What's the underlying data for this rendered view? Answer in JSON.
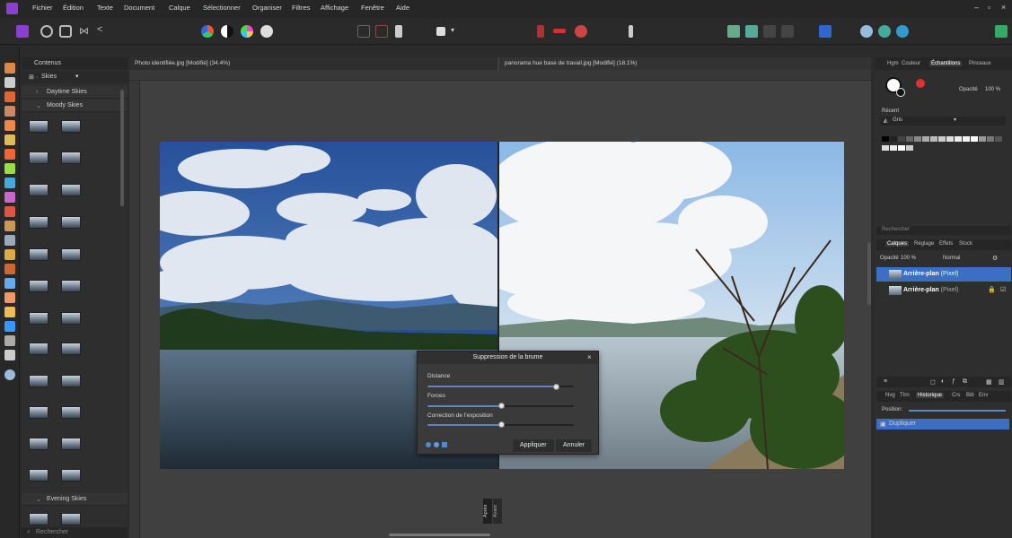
{
  "menu": [
    "Fichier",
    "Édition",
    "Texte",
    "Document",
    "Calque",
    "Sélectionner",
    "Organiser",
    "Filtres",
    "Affichage",
    "Fenêtre",
    "Aide"
  ],
  "window_controls": [
    "–",
    "▫",
    "×"
  ],
  "content_panel": {
    "tab": "Contenus",
    "category": "Skies",
    "groups": [
      "Daytime Skies",
      "Moody Skies",
      "Evening Skies"
    ],
    "search_placeholder": "Rechercher"
  },
  "documents": [
    {
      "title": "Photo identifiée.jpg [Modifié] (34.4%)"
    },
    {
      "title": "panorama hue base de travail.jpg [Modifié] (18.1%)"
    }
  ],
  "dialog": {
    "title": "Suppression de la brume",
    "sliders": [
      {
        "label": "Distance",
        "value": 0.88
      },
      {
        "label": "Forces",
        "value": 0.5
      },
      {
        "label": "Correction de l'exposition",
        "value": 0.5
      }
    ],
    "apply": "Appliquer",
    "cancel": "Annuler"
  },
  "right_panel": {
    "top_tabs": [
      "Hgm",
      "Couleur",
      "Échantillons",
      "Pinceaux"
    ],
    "active_top_tab": "Échantillons",
    "opacity_label": "Opacité",
    "opacity_value": "100 %",
    "recent_label": "Récent",
    "palette_name": "Gris",
    "search_placeholder": "Rechercher",
    "layer_tabs": [
      "Calques",
      "Réglage",
      "Effets",
      "Stock"
    ],
    "blend_opacity": "100 %",
    "blend_mode": "Normal",
    "layers": [
      {
        "name": "Arrière-plan",
        "type": "(Pixel)",
        "selected": true
      },
      {
        "name": "Arrière-plan",
        "type": "(Pixel)",
        "selected": false
      }
    ],
    "history_tabs": [
      "Nvg",
      "Ttrn",
      "Historique",
      "Crs",
      "Bib",
      "Env"
    ],
    "active_history_tab": "Historique",
    "history_label": "Position:",
    "history_items": [
      "Dupliquer"
    ]
  },
  "side_tabs": [
    "Après",
    "Avant"
  ],
  "colors": {
    "accent": "#4a7ac8",
    "selected_layer": "#3b6fc4"
  }
}
